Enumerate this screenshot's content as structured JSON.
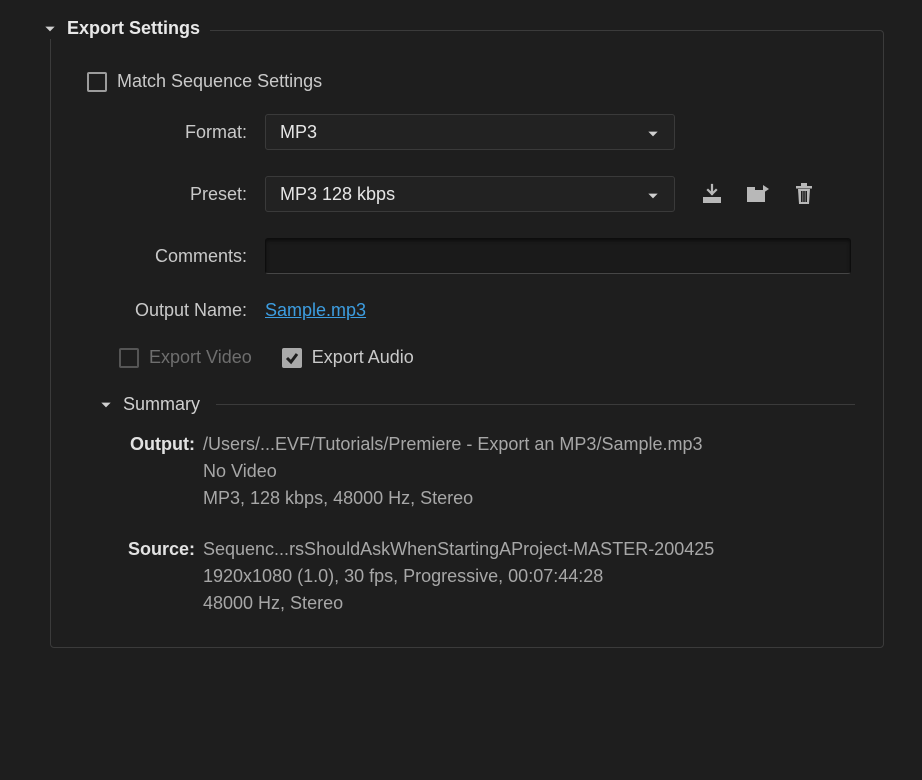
{
  "panel": {
    "title": "Export Settings"
  },
  "matchSequence": {
    "label": "Match Sequence Settings",
    "checked": false
  },
  "format": {
    "label": "Format:",
    "value": "MP3"
  },
  "preset": {
    "label": "Preset:",
    "value": "MP3 128 kbps"
  },
  "comments": {
    "label": "Comments:",
    "value": ""
  },
  "outputName": {
    "label": "Output Name:",
    "value": "Sample.mp3"
  },
  "exportVideo": {
    "label": "Export Video",
    "checked": false,
    "disabled": true
  },
  "exportAudio": {
    "label": "Export Audio",
    "checked": true
  },
  "summary": {
    "title": "Summary",
    "output": {
      "label": "Output:",
      "path": "/Users/...EVF/Tutorials/Premiere - Export an MP3/Sample.mp3",
      "video": "No Video",
      "audio": "MP3, 128 kbps, 48000 Hz, Stereo"
    },
    "source": {
      "label": "Source:",
      "name": "Sequenc...rsShouldAskWhenStartingAProject-MASTER-200425",
      "video": "1920x1080 (1.0), 30 fps, Progressive, 00:07:44:28",
      "audio": "48000 Hz, Stereo"
    }
  }
}
